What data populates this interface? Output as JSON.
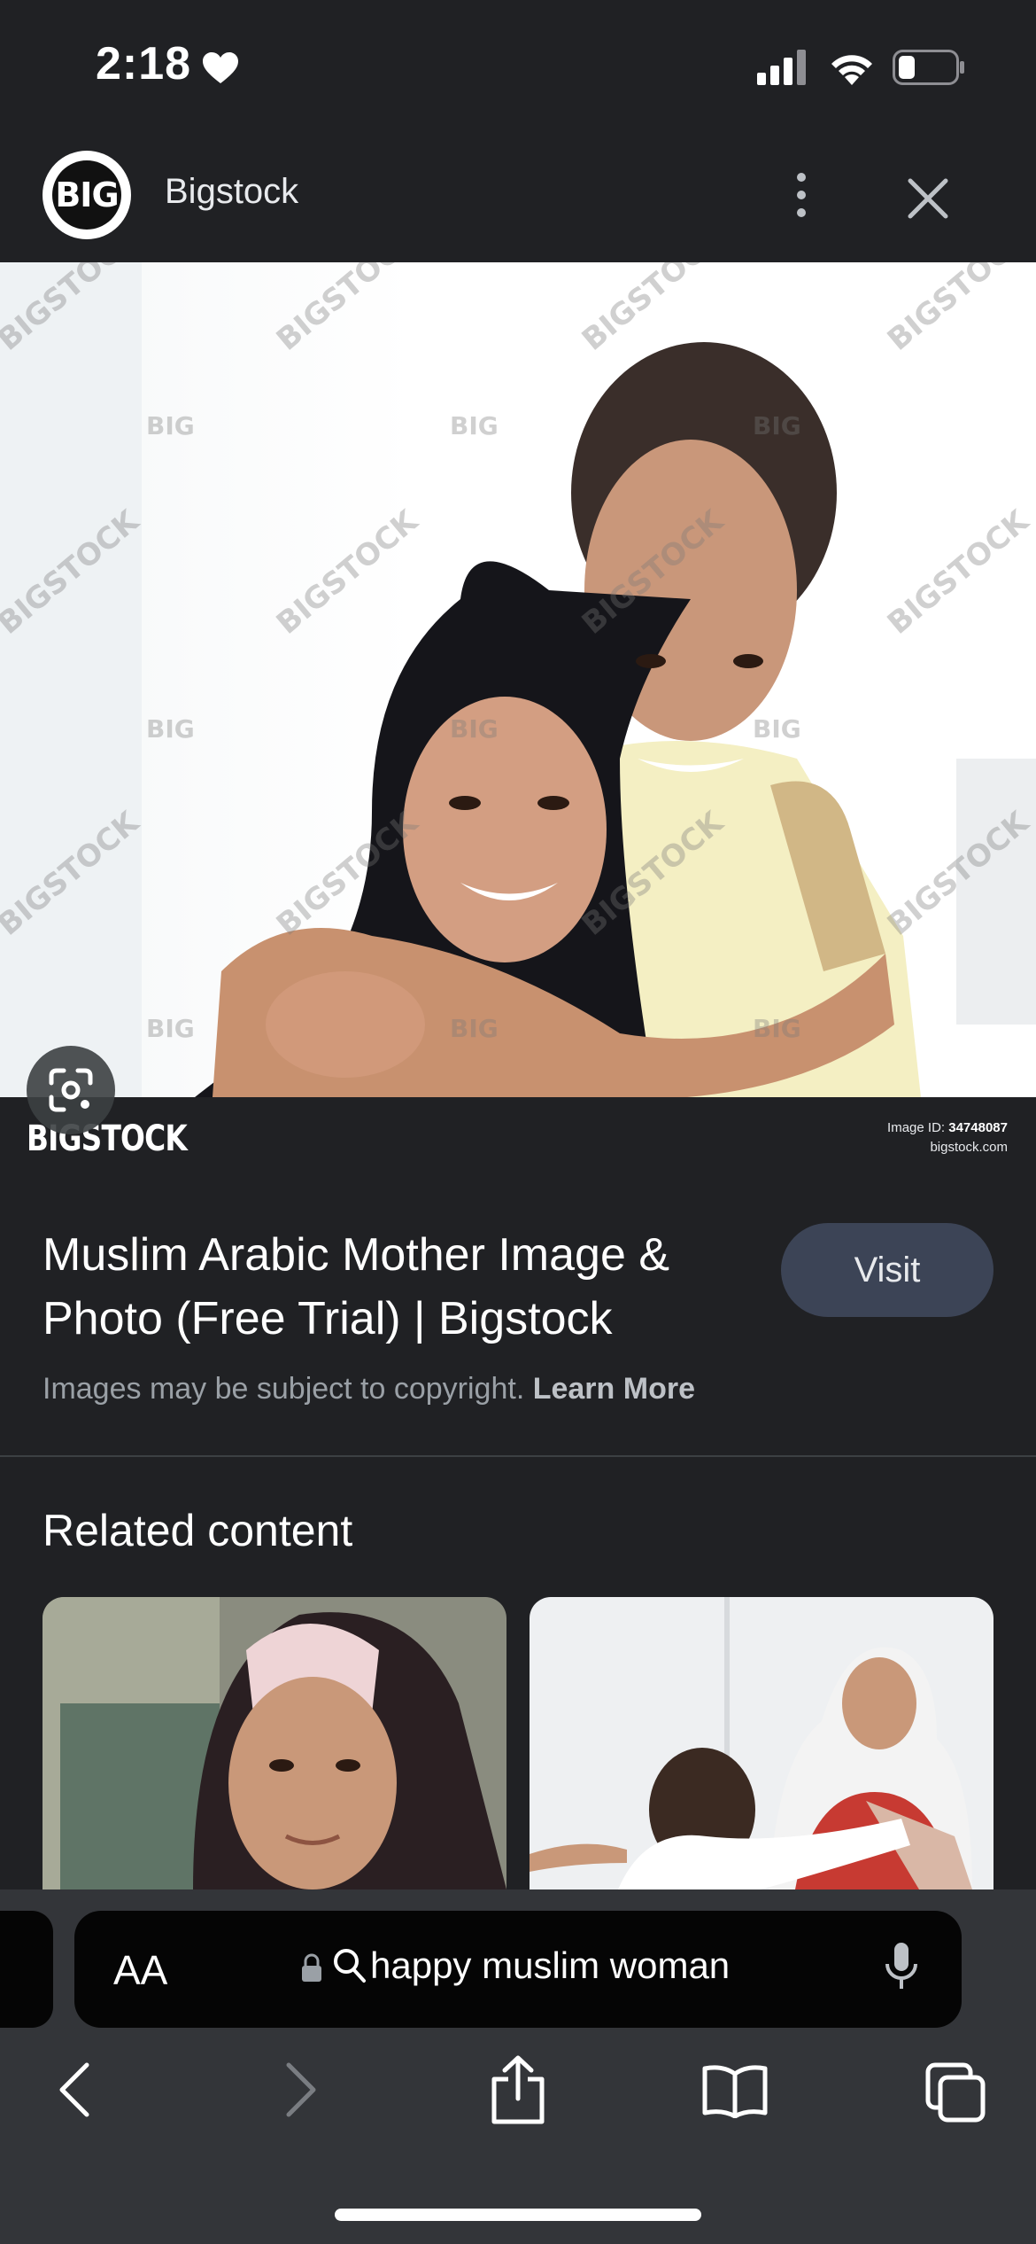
{
  "status": {
    "time": "2:18"
  },
  "header": {
    "site_name": "Bigstock",
    "logo_text": "BIG"
  },
  "image": {
    "watermark_brand": "BIGSTOCK",
    "watermark_small": "BIG",
    "id_label": "Image ID:",
    "id_value": "34748087",
    "source_url": "bigstock.com"
  },
  "result": {
    "title": "Muslim Arabic Mother Image & Photo (Free Trial) | Bigstock",
    "visit_label": "Visit",
    "copyright_text": "Images may be subject to copyright.",
    "learn_more": "Learn More"
  },
  "related": {
    "heading": "Related content"
  },
  "browser": {
    "text_size_label": "AA",
    "query": "happy muslim woman"
  },
  "colors": {
    "background": "#202124",
    "visit_button": "#3c4456",
    "toolbar": "#333539"
  }
}
